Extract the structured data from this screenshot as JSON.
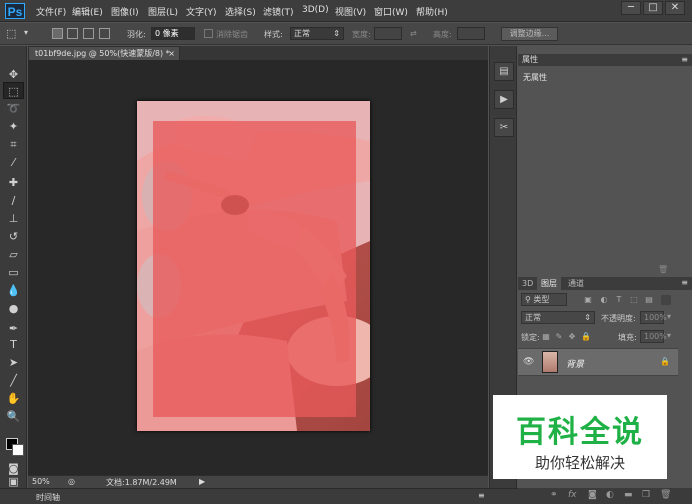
{
  "app": {
    "logo": "Ps",
    "accent": "#31a8ff"
  },
  "menu": [
    "文件(F)",
    "编辑(E)",
    "图像(I)",
    "图层(L)",
    "文字(Y)",
    "选择(S)",
    "滤镜(T)",
    "3D(D)",
    "视图(V)",
    "窗口(W)",
    "帮助(H)"
  ],
  "window_buttons": {
    "minimize": "─",
    "restore": "□",
    "close": "✕"
  },
  "options": {
    "feather_label": "羽化:",
    "feather_value": "0 像素",
    "antialias_label": "消除锯齿",
    "style_label": "样式:",
    "style_value": "正常",
    "width_label": "宽度:",
    "height_label": "高度:",
    "refine_edge": "调整边缘..."
  },
  "document": {
    "tab_title": "t01bf9de.jpg @ 50%(快速蒙版/8) *",
    "quickmask_color": "#e85a5a"
  },
  "status": {
    "zoom": "50%",
    "doc_info": "文档:1.87M/2.49M",
    "timeline": "时间轴"
  },
  "properties": {
    "tab": "属性",
    "content": "无属性"
  },
  "layers": {
    "tabs": [
      "3D",
      "图层",
      "通道"
    ],
    "filter_kind": "类型",
    "blend_mode": "正常",
    "opacity_label": "不透明度:",
    "opacity_value": "100%",
    "lock_label": "锁定:",
    "fill_label": "填充:",
    "fill_value": "100%",
    "items": [
      {
        "name": "背景"
      }
    ]
  },
  "watermark": {
    "title": "百科全说",
    "subtitle": "助你轻松解决",
    "color": "#1fb146"
  }
}
